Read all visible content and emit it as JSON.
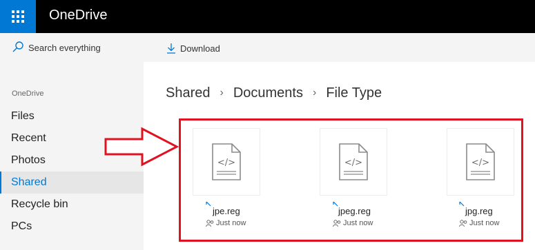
{
  "app": {
    "title": "OneDrive"
  },
  "search": {
    "placeholder": "Search everything"
  },
  "nav": {
    "section": "OneDrive",
    "items": [
      {
        "label": "Files"
      },
      {
        "label": "Recent"
      },
      {
        "label": "Photos"
      },
      {
        "label": "Shared",
        "active": true
      },
      {
        "label": "Recycle bin"
      },
      {
        "label": "PCs"
      }
    ]
  },
  "toolbar": {
    "download_label": "Download"
  },
  "breadcrumb": [
    "Shared",
    "Documents",
    "File Type"
  ],
  "files": [
    {
      "name": "jpe.reg",
      "modified": "Just now"
    },
    {
      "name": "jpeg.reg",
      "modified": "Just now"
    },
    {
      "name": "jpg.reg",
      "modified": "Just now"
    }
  ],
  "colors": {
    "accent": "#0078d4",
    "annotation": "#e0121f",
    "topbar": "#000000"
  }
}
